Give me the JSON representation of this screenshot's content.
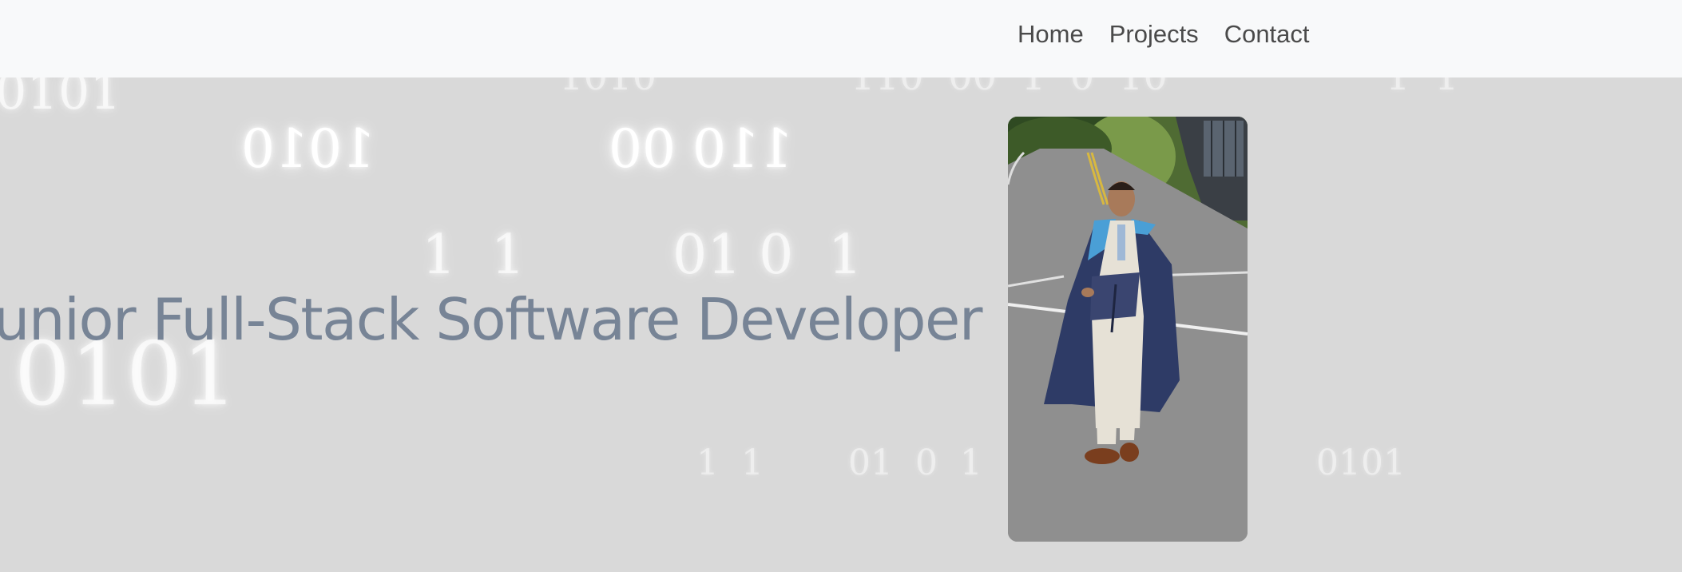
{
  "nav": {
    "links": [
      {
        "label": "Home"
      },
      {
        "label": "Projects"
      },
      {
        "label": "Contact"
      }
    ]
  },
  "hero": {
    "title": "Junior Full-Stack Software Developer"
  },
  "binary_rain": {
    "b1": "0101",
    "b2": "1010",
    "b3": "110 00",
    "b4": "1  1",
    "b5": "01 0  1",
    "b6": "0101",
    "b7": "1  1",
    "b8": "01  0  1",
    "b9": "0101",
    "b10": "1010",
    "b11": "110  00  1  0  10",
    "b12": "1  1"
  },
  "photo": {
    "subject": "graduate-portrait",
    "colors": {
      "gown": "#2e3b66",
      "hood": "#4a9fd6",
      "suit": "#e6e1d6",
      "road": "#8f8f8f",
      "foliage": "#5f7a3a"
    }
  },
  "colors": {
    "background": "#d9d9d9",
    "navbar": "#f8f9fa",
    "title": "#778496",
    "nav_text": "#4a4a4a"
  }
}
